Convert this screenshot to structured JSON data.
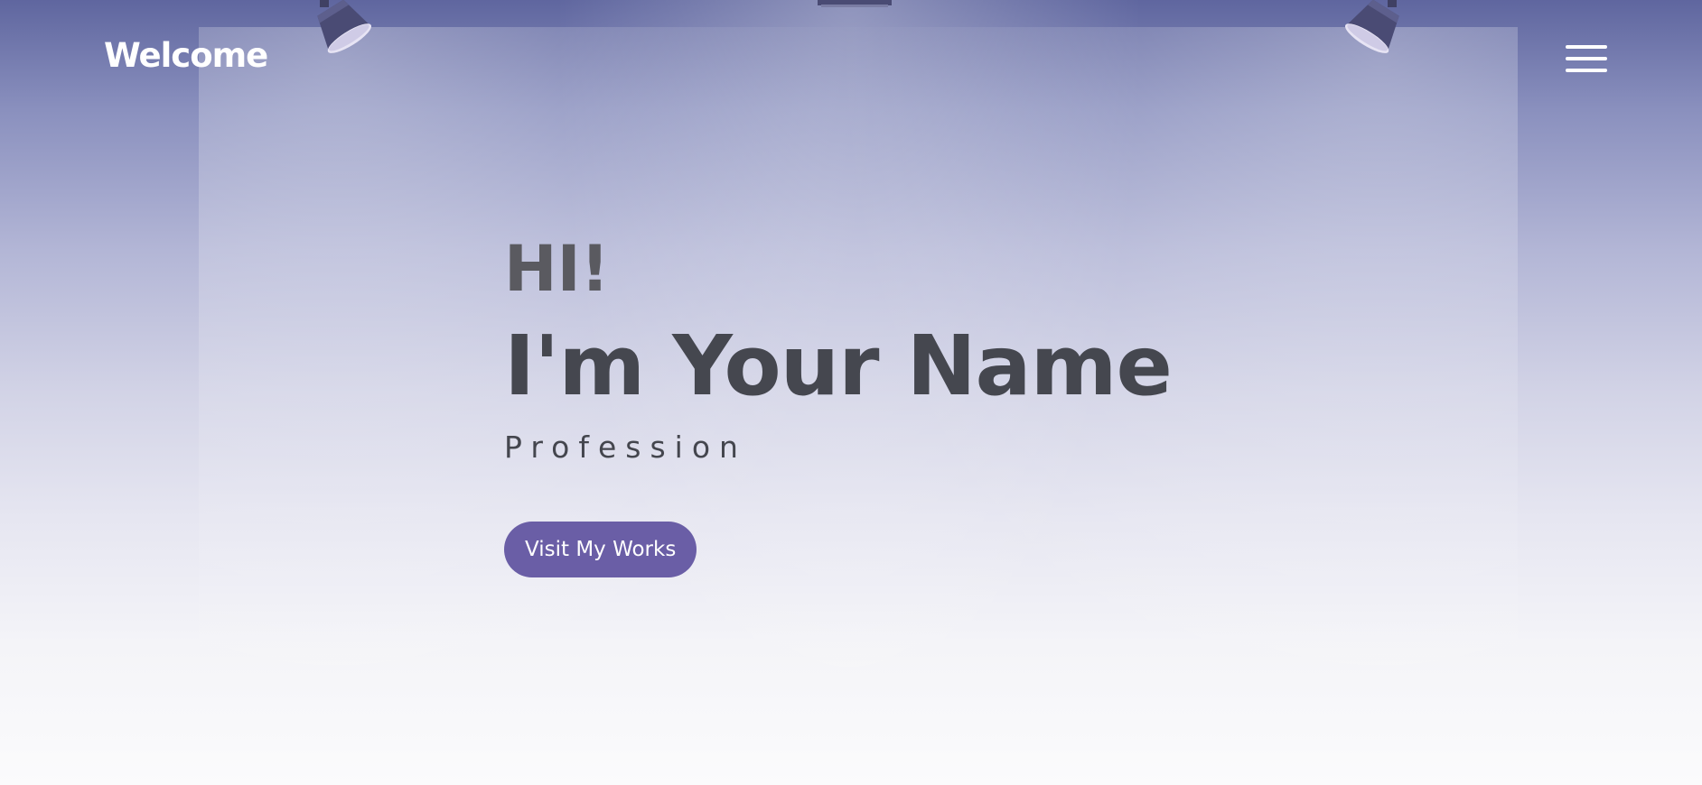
{
  "header": {
    "brand": "Welcome",
    "menu_icon": "hamburger-menu-icon"
  },
  "hero": {
    "greeting": "HI!",
    "name": "I'm Your Name",
    "profession": "Profession",
    "cta_label": "Visit My Works"
  },
  "colors": {
    "background_top": "#5f669f",
    "background_bottom": "#fbfbfc",
    "accent": "#6a5ea6",
    "heading": "#45474f",
    "greeting": "#5a5a60",
    "brand_text": "#ffffff"
  },
  "decorations": {
    "left_light": "spotlight-icon",
    "center_light": "spotlight-icon",
    "right_light": "spotlight-icon"
  }
}
